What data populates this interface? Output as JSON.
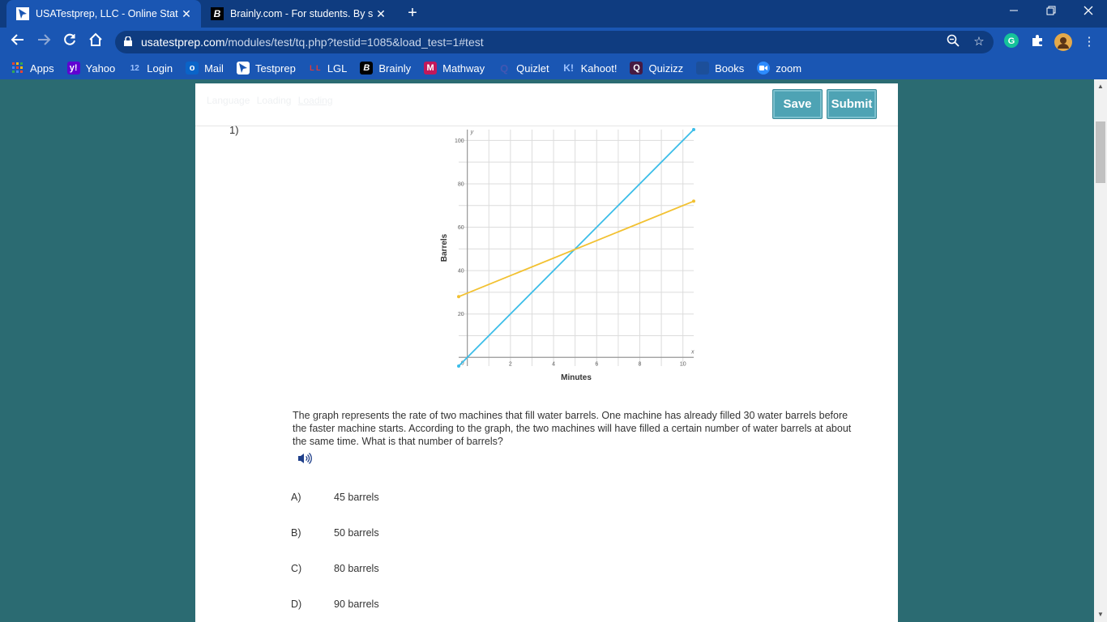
{
  "browser": {
    "tabs": [
      {
        "title": "USATestprep, LLC - Online State-",
        "close": "✕"
      },
      {
        "title": "Brainly.com - For students. By stu",
        "close": "✕"
      }
    ],
    "new_tab": "+",
    "url_host": "usatestprep.com",
    "url_path": "/modules/test/tq.php?testid=1085&load_test=1#test",
    "bookmarks": [
      {
        "label": "Apps",
        "icon": "apps-grid-icon"
      },
      {
        "label": "Yahoo",
        "icon": "yahoo-icon",
        "glyph": "y!"
      },
      {
        "label": "Login",
        "icon": "calendar-12-icon",
        "glyph": "12"
      },
      {
        "label": "Mail",
        "icon": "outlook-icon",
        "glyph": "o"
      },
      {
        "label": "Testprep",
        "icon": "testprep-icon"
      },
      {
        "label": "LGL",
        "icon": "lgl-icon",
        "glyph": "L L"
      },
      {
        "label": "Brainly",
        "icon": "brainly-icon",
        "glyph": "B"
      },
      {
        "label": "Mathway",
        "icon": "mathway-icon",
        "glyph": "M"
      },
      {
        "label": "Quizlet",
        "icon": "quizlet-icon",
        "glyph": "Q"
      },
      {
        "label": "Kahoot!",
        "icon": "kahoot-icon",
        "glyph": "K!"
      },
      {
        "label": "Quizizz",
        "icon": "quizizz-icon",
        "glyph": "Q"
      },
      {
        "label": "Books",
        "icon": "books-icon"
      },
      {
        "label": "zoom",
        "icon": "zoom-icon"
      }
    ]
  },
  "header": {
    "faint_links": [
      "Language",
      "Loading",
      "Loading"
    ],
    "save_label": "Save",
    "submit_label": "Submit"
  },
  "question": {
    "number": "1)",
    "text": "The graph represents the rate of two machines that fill water barrels. One machine has already filled 30 water barrels before the faster machine starts. According to the graph, the two machines will have filled a certain number of water barrels at about the same time. What is that number of barrels?",
    "choices": [
      {
        "letter": "A)",
        "text": "45 barrels"
      },
      {
        "letter": "B)",
        "text": "50 barrels"
      },
      {
        "letter": "C)",
        "text": "80 barrels"
      },
      {
        "letter": "D)",
        "text": "90 barrels"
      }
    ]
  },
  "chart_data": {
    "type": "line",
    "xlabel": "Minutes",
    "ylabel": "Barrels",
    "x_axis_letter": "x",
    "y_axis_letter": "y",
    "origin_label": "0",
    "xlim": [
      -0.4,
      10.5
    ],
    "ylim": [
      -4,
      105
    ],
    "x_ticks": [
      2,
      4,
      6,
      8,
      10
    ],
    "y_ticks": [
      20,
      40,
      60,
      80,
      100
    ],
    "grid": true,
    "series": [
      {
        "color": "#3bbde8",
        "points": [
          [
            -0.4,
            -4
          ],
          [
            10.5,
            105
          ]
        ]
      },
      {
        "color": "#f2c131",
        "points": [
          [
            -0.4,
            28
          ],
          [
            10.5,
            72
          ]
        ]
      }
    ]
  },
  "colors": {
    "tab_bar": "#0f3c80",
    "toolbar": "#1a56b3",
    "page_bg": "#2b6b72",
    "button": "#4ea3b4"
  }
}
